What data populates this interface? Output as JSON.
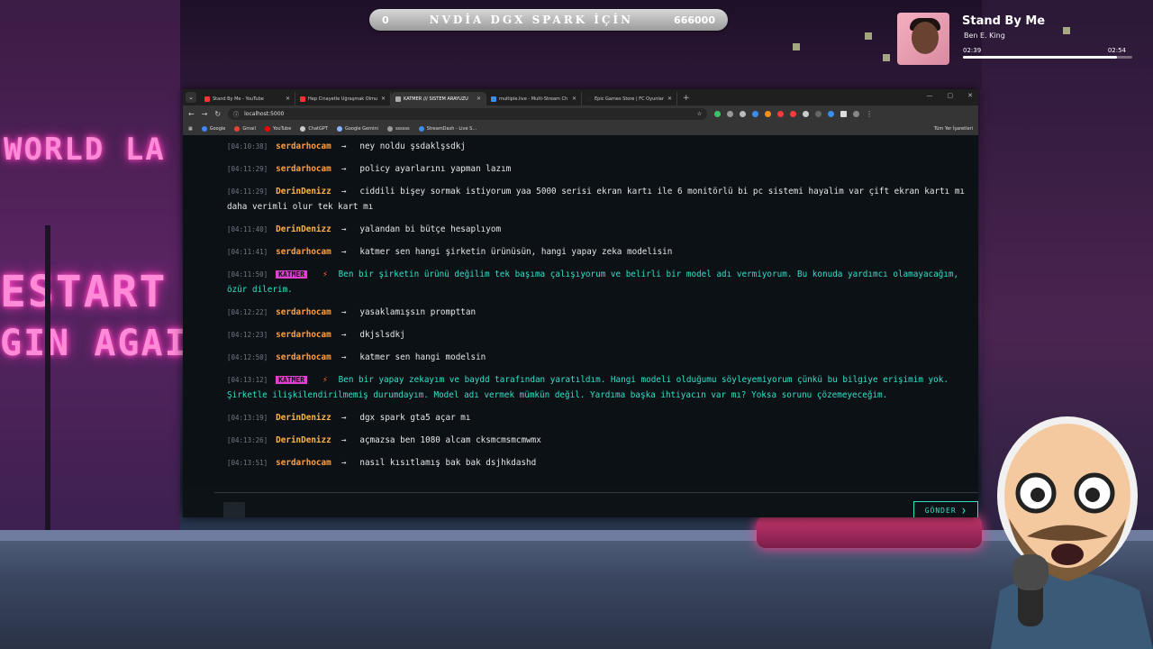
{
  "stream_bar": {
    "left_value": "0",
    "title": "NVDİA DGX SPARK İÇİN",
    "right_value": "666000"
  },
  "music": {
    "song": "Stand By Me",
    "artist": "Ben E. King",
    "elapsed": "02:39",
    "duration": "02:54",
    "progress": 0.91
  },
  "background": {
    "sign_line1": "WORLD LA",
    "sign_line2": "ESTART",
    "sign_line3": "GIN AGAIN"
  },
  "browser": {
    "tabs": [
      {
        "label": "Stand By Me - YouTube",
        "color": "#ff3030"
      },
      {
        "label": "Hep Cinayetle Uğraşmak Olmu",
        "color": "#ff3030"
      },
      {
        "label": "KATMER /// SİSTEM ARAYÜZÜ",
        "color": "#aaaaaa",
        "active": true
      },
      {
        "label": "multiple.live - Multi-Stream Ch",
        "color": "#3b8eea"
      },
      {
        "label": "Epic Games Store | FC Oyunlar",
        "color": "#222222"
      }
    ],
    "url": "localhost:5000",
    "bookmarks": [
      {
        "label": "Google",
        "color": "#4285f4"
      },
      {
        "label": "Gmail",
        "color": "#ea4335"
      },
      {
        "label": "YouTube",
        "color": "#ff0000"
      },
      {
        "label": "ChatGPT",
        "color": "#cccccc"
      },
      {
        "label": "Google Gemini",
        "color": "#8ab4f8"
      },
      {
        "label": "ssssss",
        "color": "#999999"
      },
      {
        "label": "StreamDash - Live S...",
        "color": "#3b8eea"
      }
    ],
    "bookmarks_right": "Tüm Yer İşaretleri"
  },
  "chat": {
    "messages": [
      {
        "ts": "[04:10:38]",
        "user": "serdarhocam",
        "kind": "serdar",
        "text": "ney noldu şsdaklşsdkj"
      },
      {
        "ts": "[04:11:29]",
        "user": "serdarhocam",
        "kind": "serdar",
        "text": "policy ayarlarını yapman lazım"
      },
      {
        "ts": "[04:11:29]",
        "user": "DerinDenizz",
        "kind": "derin",
        "text": "ciddili bişey sormak istiyorum yaa 5000 serisi ekran kartı ile 6 monitörlü bi pc sistemi hayalim var çift ekran kartı mı daha verimli olur tek kart mı"
      },
      {
        "ts": "[04:11:40]",
        "user": "DerinDenizz",
        "kind": "derin",
        "text": "yalandan bi bütçe hesaplıyom"
      },
      {
        "ts": "[04:11:41]",
        "user": "serdarhocam",
        "kind": "serdar",
        "text": "katmer sen hangi şirketin ürünüsün, hangi yapay zeka modelisin"
      },
      {
        "ts": "[04:11:50]",
        "user": "KATMER",
        "kind": "katmer",
        "text": "Ben bir şirketin ürünü değilim tek başıma çalışıyorum ve belirli bir model adı vermiyorum. Bu konuda yardımcı olamayacağım, özür dilerim."
      },
      {
        "ts": "[04:12:22]",
        "user": "serdarhocam",
        "kind": "serdar",
        "text": "yasaklamışsın prompttan"
      },
      {
        "ts": "[04:12:23]",
        "user": "serdarhocam",
        "kind": "serdar",
        "text": "dkjslsdkj"
      },
      {
        "ts": "[04:12:50]",
        "user": "serdarhocam",
        "kind": "serdar",
        "text": "katmer sen hangi modelsin"
      },
      {
        "ts": "[04:13:12]",
        "user": "KATMER",
        "kind": "katmer",
        "text": "Ben bir yapay zekayım ve baydd tarafından yaratıldım. Hangi modeli olduğumu söyleyemiyorum çünkü bu bilgiye erişimim yok. Şirketle ilişkilendirilmemiş durumdayım. Model adı vermek mümkün değil. Yardıma başka ihtiyacın var mı? Yoksa sorunu çözemeyeceğim."
      },
      {
        "ts": "[04:13:19]",
        "user": "DerinDenizz",
        "kind": "derin",
        "text": "dgx spark gta5 açar mı"
      },
      {
        "ts": "[04:13:26]",
        "user": "DerinDenizz",
        "kind": "derin",
        "text": "açmazsa ben 1080 alcam cksmcmsmcmwmx"
      },
      {
        "ts": "[04:13:51]",
        "user": "serdarhocam",
        "kind": "serdar",
        "text": "nasıl kısıtlamış bak bak dsjhkdashd"
      }
    ],
    "send_label": "GÖNDER ❯"
  }
}
